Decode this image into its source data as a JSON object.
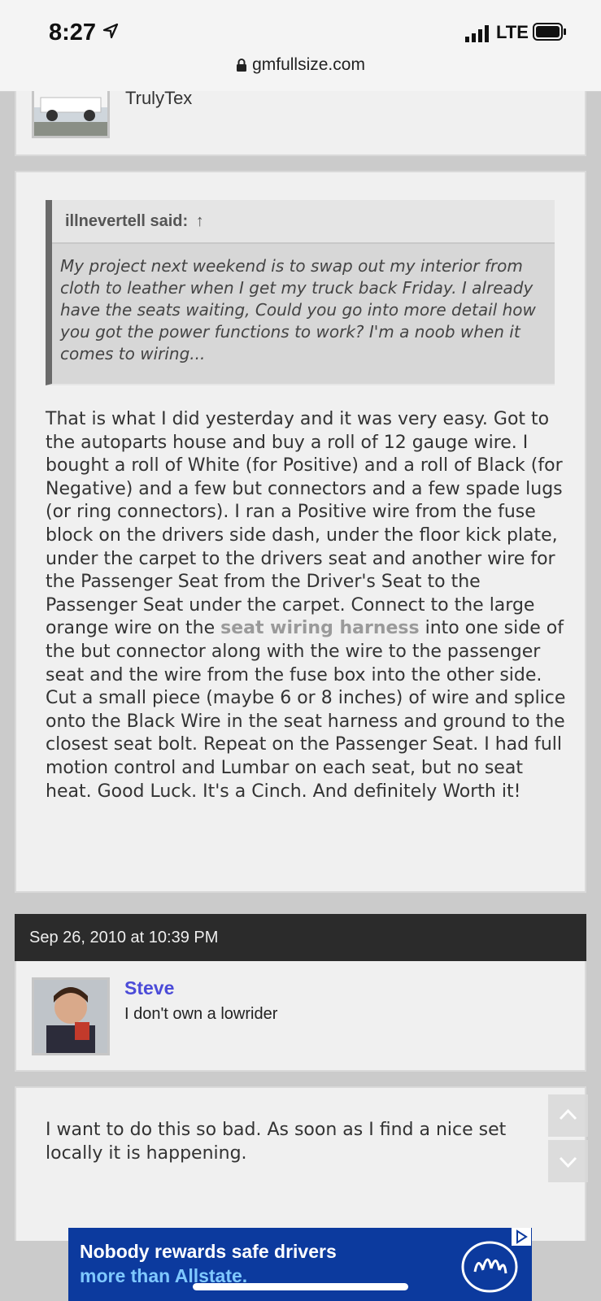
{
  "status": {
    "time": "8:27",
    "network": "LTE"
  },
  "browser": {
    "url": "gmfullsize.com"
  },
  "prev_post": {
    "username": "TrulyTex"
  },
  "quote": {
    "header": "illnevertell said:",
    "arrow": "↑",
    "text": "My project next weekend is to swap out my interior from cloth to leather when I get my truck back Friday. I already have the seats waiting, Could you go into more detail how you got the power functions to work? I'm a noob when it comes to wiring..."
  },
  "post": {
    "text_before": "That is what I did yesterday and it was very easy. Got to the autoparts house and buy a roll of 12 gauge wire. I bought a roll of White (for Positive) and a roll of Black (for Negative) and a few but connectors and a few spade lugs (or ring connectors). I ran a Positive wire from the fuse block on the drivers side dash, under the floor kick plate, under the carpet to the drivers seat and another wire for the Passenger Seat from the Driver's Seat to the Passenger Seat under the carpet. Connect to the large orange wire on the ",
    "link": "seat wiring harness",
    "text_after": " into one side of the but connector along with the wire to the passenger seat and the wire from the fuse box into the other side. Cut a small piece (maybe 6 or 8 inches) of wire and splice onto the Black Wire in the seat harness and ground to the closest seat bolt. Repeat on the Passenger Seat. I had full motion control and Lumbar on each seat, but no seat heat. Good Luck. It's a Cinch. And definitely Worth it!"
  },
  "next_post": {
    "date": "Sep 26, 2010 at 10:39 PM",
    "username": "Steve",
    "user_title": "I don't own a lowrider",
    "text": "I want to do this so bad. As soon as I find a nice set locally it is happening."
  },
  "ad": {
    "line1": "Nobody rewards safe drivers",
    "line2": "more than Allstate."
  },
  "colors": {
    "username": "#4b4bd8",
    "ad_bg": "#0c3a9e",
    "date_bar": "#2b2b2b"
  }
}
